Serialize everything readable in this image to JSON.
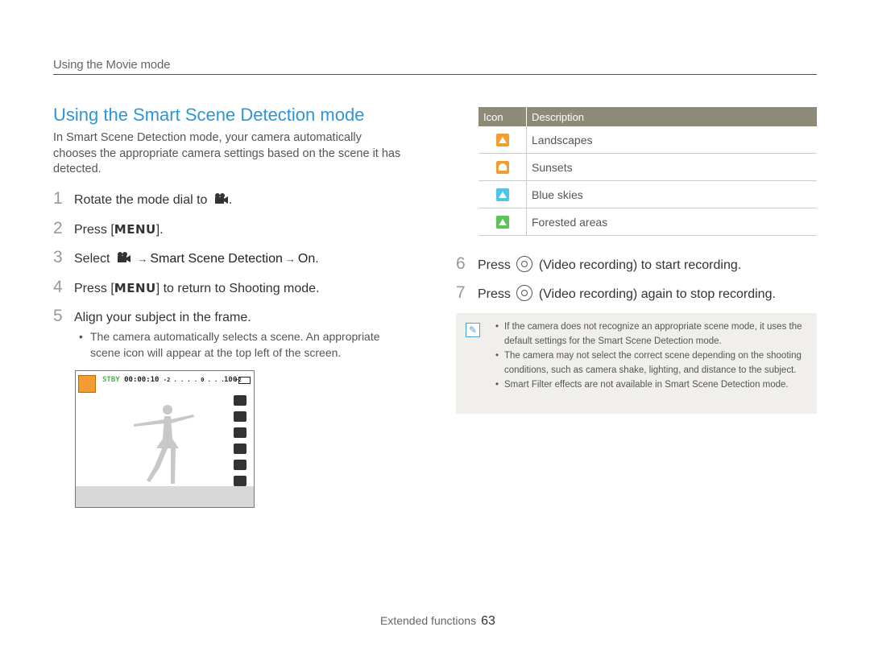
{
  "header": {
    "section": "Using the Movie mode"
  },
  "title": "Using the Smart Scene Detection mode",
  "intro": "In Smart Scene Detection mode, your camera automatically chooses the appropriate camera settings based on the scene it has detected.",
  "steps": [
    {
      "num": "1",
      "text": "Rotate the mode dial to"
    },
    {
      "num": "2",
      "text_a": "Press [",
      "key": "MENU",
      "text_b": "]."
    },
    {
      "num": "3",
      "text_a": "Select",
      "arrow": "→",
      "bold_a": "Smart Scene Detection",
      "bold_b": "On",
      "end": "."
    },
    {
      "num": "4",
      "text_a": "Press [",
      "key": "MENU",
      "text_b": "] to return to Shooting mode."
    },
    {
      "num": "5",
      "text": "Align your subject in the frame."
    }
  ],
  "sub_bullet": "The camera automatically selects a scene. An appropriate scene icon will appear at the top left of the screen.",
  "preview": {
    "stby": "STBY",
    "time": "00:00:10",
    "ev": "-2 . . . . 0 . . . . +2",
    "count": "100"
  },
  "table": {
    "headers": [
      "Icon",
      "Description"
    ],
    "rows": [
      {
        "icon": "landscape-icon",
        "color": "#f39c32",
        "label": "Landscapes"
      },
      {
        "icon": "sunset-icon",
        "color": "#f39c32",
        "label": "Sunsets"
      },
      {
        "icon": "blue-sky-icon",
        "color": "#4fc3e8",
        "label": "Blue skies"
      },
      {
        "icon": "forest-icon",
        "color": "#5cc254",
        "label": "Forested areas"
      }
    ]
  },
  "right_steps": [
    {
      "num": "6",
      "a": "Press",
      "b": "(Video recording) to start recording."
    },
    {
      "num": "7",
      "a": "Press",
      "b": "(Video recording) again to stop recording."
    }
  ],
  "notes": [
    "If the camera does not recognize an appropriate scene mode, it uses the default settings for the Smart Scene Detection mode.",
    "The camera may not select the correct scene depending on the shooting conditions, such as camera shake, lighting, and distance to the subject.",
    "Smart Filter effects are not available in Smart Scene Detection mode."
  ],
  "footer": {
    "label": "Extended functions",
    "page": "63"
  }
}
